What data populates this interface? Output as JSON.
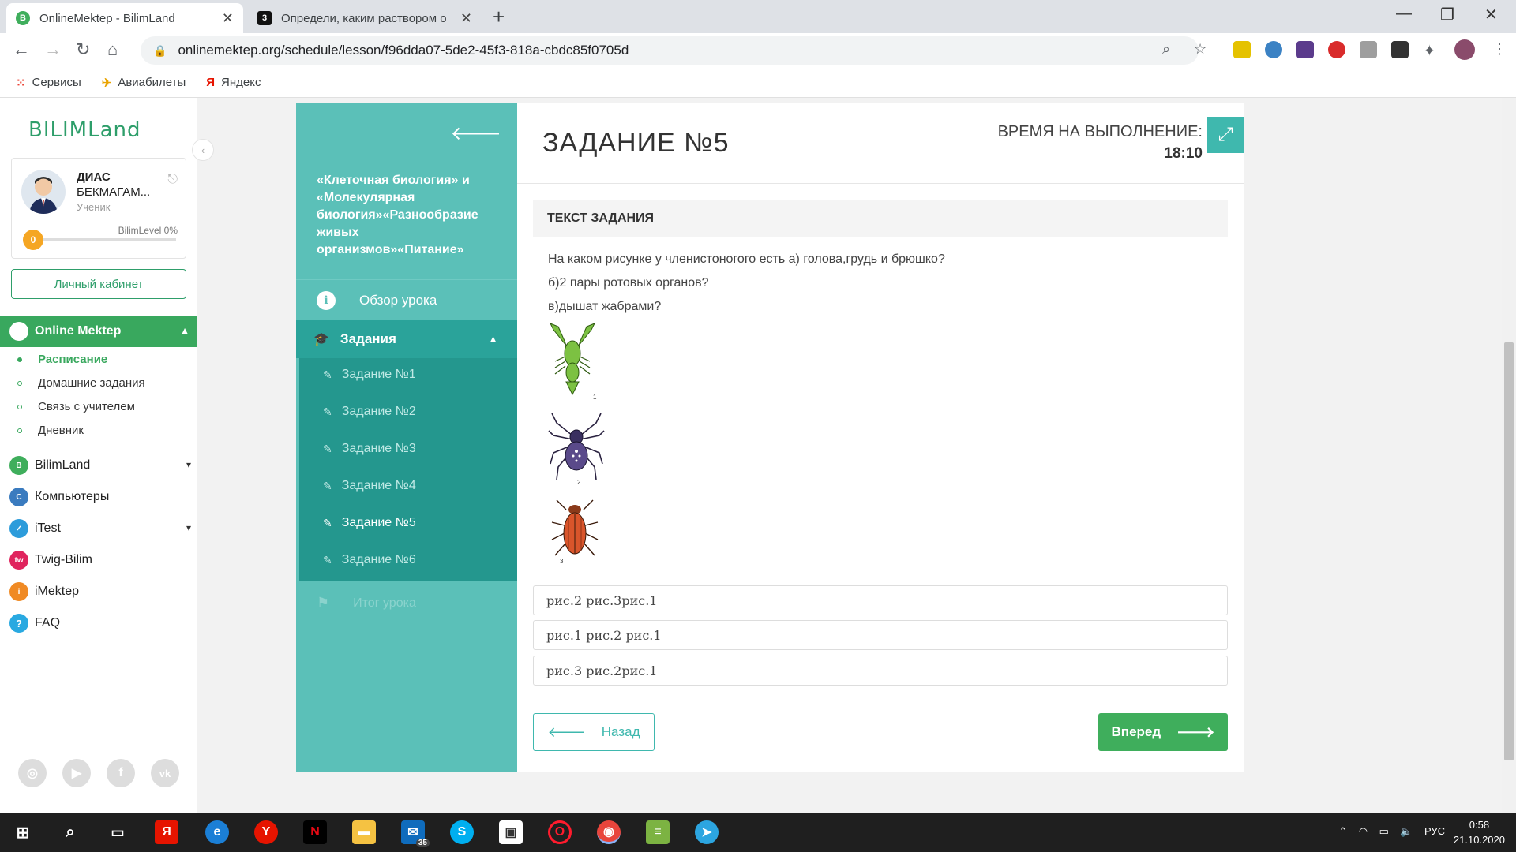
{
  "browser": {
    "tabs": [
      {
        "title": "OnlineMektep - BilimLand",
        "active": true,
        "favicon": "B"
      },
      {
        "title": "Определи, каким раствором о",
        "active": false,
        "favicon": "3"
      }
    ],
    "new_tab": "+",
    "window_controls": {
      "minimize": "—",
      "maximize": "❐",
      "close": "✕"
    },
    "url": "onlinemektep.org/schedule/lesson/f96dda07-5de2-45f3-818a-cbdc85f0705d",
    "bookmarks": [
      {
        "label": "Сервисы",
        "icon": "apps-icon"
      },
      {
        "label": "Авиабилеты",
        "icon": "plane-icon"
      },
      {
        "label": "Яндекс",
        "icon": "yandex-icon"
      }
    ]
  },
  "sidebar": {
    "logo": "BILIMLand",
    "profile": {
      "first_name": "ДИАС",
      "last_name": "БЕКМАГАМ...",
      "role": "Ученик",
      "level_label": "BilimLevel 0%",
      "level_value": "0",
      "level_fraction": 0
    },
    "cabinet_button": "Личный кабинет",
    "online_mektep": "Online Mektep",
    "sub_items": [
      {
        "label": "Расписание",
        "active": true
      },
      {
        "label": "Домашние задания",
        "active": false
      },
      {
        "label": "Связь с учителем",
        "active": false
      },
      {
        "label": "Дневник",
        "active": false
      }
    ],
    "main_items": [
      {
        "label": "BilimLand",
        "color": "#3fae5c",
        "chevron": true
      },
      {
        "label": "Компьютеры",
        "color": "#3a7bbf",
        "chevron": false
      },
      {
        "label": "iTest",
        "color": "#2d9cdb",
        "chevron": true
      },
      {
        "label": "Twig-Bilim",
        "color": "#e0245e",
        "chevron": false
      },
      {
        "label": "iMektep",
        "color": "#f08a24",
        "chevron": false
      },
      {
        "label": "FAQ",
        "color": "#29a9e1",
        "chevron": false
      }
    ]
  },
  "lesson": {
    "title": "«Клеточная биология» и «Молекулярная биология»«Разнообразие живых организмов»«Питание»",
    "overview": "Обзор урока",
    "tasks_header": "Задания",
    "tasks": [
      {
        "label": "Задание №1",
        "active": false
      },
      {
        "label": "Задание №2",
        "active": false
      },
      {
        "label": "Задание №3",
        "active": false
      },
      {
        "label": "Задание №4",
        "active": false
      },
      {
        "label": "Задание №5",
        "active": true
      },
      {
        "label": "Задание №6",
        "active": false
      }
    ],
    "summary": "Итог урока"
  },
  "task": {
    "title": "ЗАДАНИЕ №5",
    "time_label": "ВРЕМЯ НА ВЫПОЛНЕНИЕ:",
    "time_value": "18:10",
    "text_header": "ТЕКСТ ЗАДАНИЯ",
    "question_lines": [
      "На каком рисунке у членистоногого есть а) голова,грудь и брюшко?",
      "б)2 пары ротовых органов?",
      "в)дышат жабрами?"
    ],
    "pictures": [
      {
        "name": "crayfish-picture",
        "number": "1",
        "color": "#7cc142"
      },
      {
        "name": "spider-picture",
        "number": "2",
        "color": "#5a4a8a"
      },
      {
        "name": "beetle-picture",
        "number": "3",
        "color": "#d9552b"
      }
    ],
    "answers": [
      "рис.2 рис.3рис.1",
      "рис.1 рис.2 рис.1",
      "рис.3 рис.2рис.1"
    ],
    "back_button": "Назад",
    "next_button": "Вперед"
  },
  "taskbar": {
    "mail_badge": "35",
    "language": "РУС",
    "time": "0:58",
    "date": "21.10.2020"
  }
}
